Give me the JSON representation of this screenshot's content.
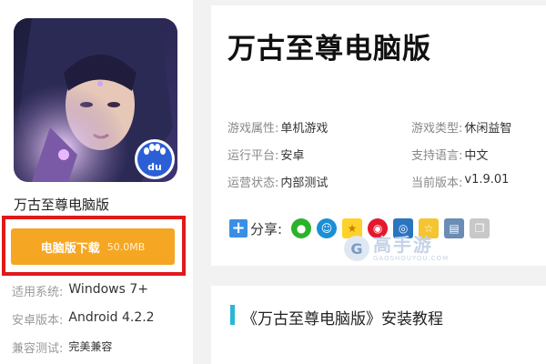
{
  "app": {
    "name": "万古至尊电脑版",
    "icon_badge": "du"
  },
  "download": {
    "label": "电脑版下载",
    "size": "50.0MB",
    "accent_color": "#f5a623",
    "highlight_color": "#e01a1a"
  },
  "specs": [
    {
      "label": "适用系统:",
      "value": "Windows 7+"
    },
    {
      "label": "安卓版本:",
      "value": "Android 4.2.2"
    },
    {
      "label": "兼容测试:",
      "value": "完美兼容"
    }
  ],
  "game": {
    "title": "万古至尊电脑版",
    "attributes": [
      {
        "label": "游戏属性:",
        "value": "单机游戏"
      },
      {
        "label": "游戏类型:",
        "value": "休闲益智"
      },
      {
        "label": "运行平台:",
        "value": "安卓"
      },
      {
        "label": "支持语言:",
        "value": "中文"
      },
      {
        "label": "运营状态:",
        "value": "内部测试"
      },
      {
        "label": "当前版本:",
        "value": "v1.9.01"
      }
    ]
  },
  "share": {
    "label": "分享:",
    "icons": [
      "wechat-icon",
      "qq-icon",
      "star-icon",
      "weibo-icon",
      "renren-icon",
      "qzone-icon",
      "print-icon",
      "copy-icon"
    ]
  },
  "watermark": {
    "main": "高手游",
    "sub": "GAOSHOUYOU.COM"
  },
  "tutorial": {
    "title": "《万古至尊电脑版》安装教程",
    "accent_color": "#2ab7d4"
  }
}
